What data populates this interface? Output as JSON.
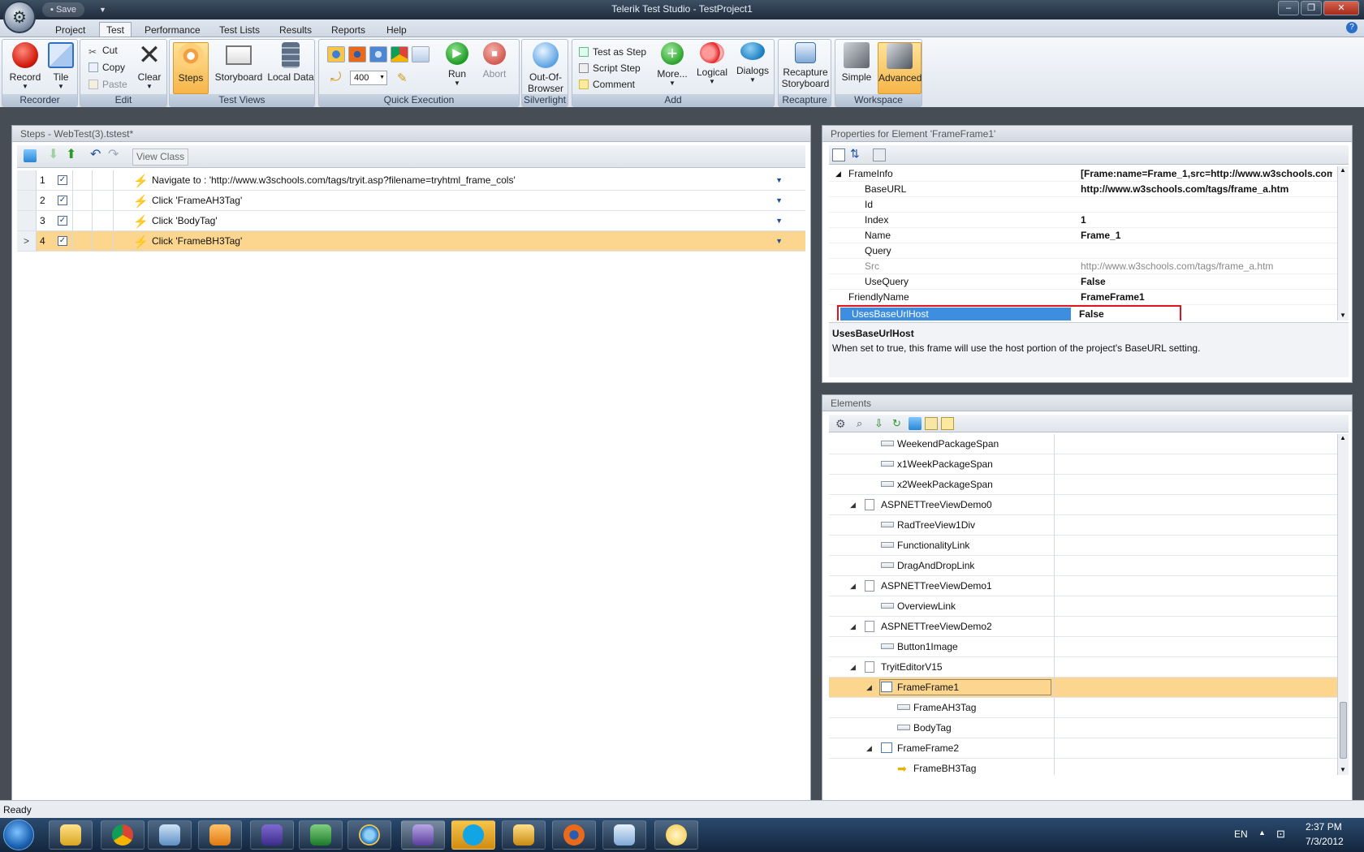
{
  "window": {
    "title": "Telerik Test Studio - TestProject1",
    "qat_save": "Save"
  },
  "ribbon": {
    "tabs": [
      "Project",
      "Test",
      "Performance",
      "Test Lists",
      "Results",
      "Reports",
      "Help"
    ],
    "active_tab": "Test",
    "groups": {
      "recorder": {
        "label": "Recorder",
        "record": "Record",
        "tile": "Tile"
      },
      "edit": {
        "label": "Edit",
        "cut": "Cut",
        "copy": "Copy",
        "paste": "Paste",
        "clear": "Clear"
      },
      "test_views": {
        "label": "Test Views",
        "steps": "Steps",
        "storyboard": "Storyboard",
        "local_data": "Local Data"
      },
      "quick_execution": {
        "label": "Quick Execution",
        "speed": "400",
        "run": "Run",
        "abort": "Abort"
      },
      "silverlight": {
        "label": "Silverlight",
        "oob_line1": "Out-Of-",
        "oob_line2": "Browser"
      },
      "add": {
        "label": "Add",
        "test_as_step": "Test as Step",
        "script_step": "Script Step",
        "comment": "Comment",
        "more": "More...",
        "logical": "Logical",
        "dialogs": "Dialogs"
      },
      "recapture": {
        "label": "Recapture",
        "btn_line1": "Recapture",
        "btn_line2": "Storyboard"
      },
      "workspace": {
        "label": "Workspace",
        "simple": "Simple",
        "advanced": "Advanced"
      }
    }
  },
  "steps_panel": {
    "title": "Steps - WebTest(3).tstest*",
    "view_class": "View Class",
    "steps": [
      {
        "num": "1",
        "text": "Navigate to : 'http://www.w3schools.com/tags/tryit.asp?filename=tryhtml_frame_cols'"
      },
      {
        "num": "2",
        "text": "Click 'FrameAH3Tag'"
      },
      {
        "num": "3",
        "text": "Click 'BodyTag'"
      },
      {
        "num": "4",
        "text": "Click 'FrameBH3Tag'",
        "selected_marker": ">"
      }
    ]
  },
  "properties_panel": {
    "title": "Properties for Element 'FrameFrame1'",
    "rows": [
      {
        "name": "FrameInfo",
        "value": "[Frame:name=Frame_1,src=http://www.w3schools.com"
      },
      {
        "name": "BaseURL",
        "value": "http://www.w3schools.com/tags/frame_a.htm"
      },
      {
        "name": "Id",
        "value": ""
      },
      {
        "name": "Index",
        "value": "1"
      },
      {
        "name": "Name",
        "value": "Frame_1"
      },
      {
        "name": "Query",
        "value": ""
      },
      {
        "name": "Src",
        "value": "http://www.w3schools.com/tags/frame_a.htm"
      },
      {
        "name": "UseQuery",
        "value": "False"
      },
      {
        "name": "FriendlyName",
        "value": "FrameFrame1"
      },
      {
        "name": "UsesBaseUrlHost",
        "value": "False"
      }
    ],
    "desc_title": "UsesBaseUrlHost",
    "desc_text": "When set to true, this frame will use the host portion of the project's BaseURL setting."
  },
  "elements_panel": {
    "title": "Elements",
    "items": [
      {
        "label": "WeekendPackageSpan"
      },
      {
        "label": "x1WeekPackageSpan"
      },
      {
        "label": "x2WeekPackageSpan"
      },
      {
        "label": "ASPNETTreeViewDemo0"
      },
      {
        "label": "RadTreeView1Div"
      },
      {
        "label": "FunctionalityLink"
      },
      {
        "label": "DragAndDropLink"
      },
      {
        "label": "ASPNETTreeViewDemo1"
      },
      {
        "label": "OverviewLink"
      },
      {
        "label": "ASPNETTreeViewDemo2"
      },
      {
        "label": "Button1Image"
      },
      {
        "label": "TryitEditorV15"
      },
      {
        "label": "FrameFrame1"
      },
      {
        "label": "FrameAH3Tag"
      },
      {
        "label": "BodyTag"
      },
      {
        "label": "FrameFrame2"
      },
      {
        "label": "FrameBH3Tag"
      }
    ]
  },
  "status": {
    "text": "Ready"
  },
  "taskbar": {
    "lang": "EN",
    "time": "2:37 PM",
    "date": "7/3/2012"
  }
}
